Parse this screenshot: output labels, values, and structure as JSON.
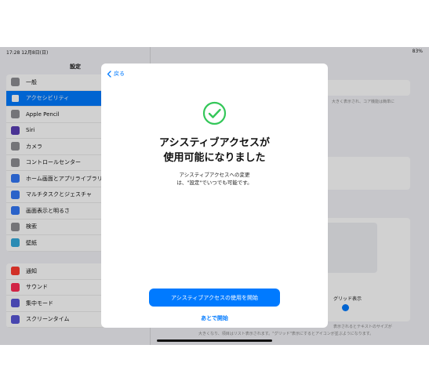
{
  "status_bar": {
    "time_date": "17:28  12月8日(日)",
    "indicators": "83%"
  },
  "sidebar": {
    "title": "設定",
    "group1": [
      {
        "label": "一般",
        "icon": "gear-icon",
        "color": "#8e8e93"
      },
      {
        "label": "アクセシビリティ",
        "icon": "accessibility-icon",
        "color": "#007aff",
        "selected": true
      },
      {
        "label": "Apple Pencil",
        "icon": "pencil-icon",
        "color": "#8e8e93"
      },
      {
        "label": "Siri",
        "icon": "siri-icon",
        "color": "#5b3fb5"
      },
      {
        "label": "カメラ",
        "icon": "camera-icon",
        "color": "#8e8e93"
      },
      {
        "label": "コントロールセンター",
        "icon": "control-center-icon",
        "color": "#8e8e93"
      },
      {
        "label": "ホーム画面とアプリライブラリ",
        "icon": "home-screen-icon",
        "color": "#3478f6"
      },
      {
        "label": "マルチタスクとジェスチャ",
        "icon": "multitask-icon",
        "color": "#3478f6"
      },
      {
        "label": "画面表示と明るさ",
        "icon": "brightness-icon",
        "color": "#3478f6"
      },
      {
        "label": "検索",
        "icon": "search-icon",
        "color": "#8e8e93"
      },
      {
        "label": "壁紙",
        "icon": "wallpaper-icon",
        "color": "#34aadc"
      }
    ],
    "group2": [
      {
        "label": "通知",
        "icon": "bell-icon",
        "color": "#ff3b30"
      },
      {
        "label": "サウンド",
        "icon": "speaker-icon",
        "color": "#ff2d55"
      },
      {
        "label": "集中モード",
        "icon": "moon-icon",
        "color": "#5856d6"
      },
      {
        "label": "スクリーンタイム",
        "icon": "hourglass-icon",
        "color": "#5856d6"
      }
    ]
  },
  "detail": {
    "grid_label": "グリッド表示",
    "footnote_1": "表示されるとテキストのサイズが",
    "footnote_2": "大きくなり、項目はリスト表示されます。\"グリッド\"表示にするとアイコンが並ぶようになります。",
    "top_note": "大きく表示され、コア機能は簡単に"
  },
  "modal": {
    "back_label": "戻る",
    "title_line1": "アシスティブアクセスが",
    "title_line2": "使用可能になりました",
    "desc_line1": "アシスティブアクセスへの変更",
    "desc_line2": "は、\"設定\"でいつでも可能です。",
    "primary_button": "アシスティブアクセスの使用を開始",
    "secondary_button": "あとで開始",
    "accent_color": "#007aff",
    "check_color": "#34c759"
  }
}
